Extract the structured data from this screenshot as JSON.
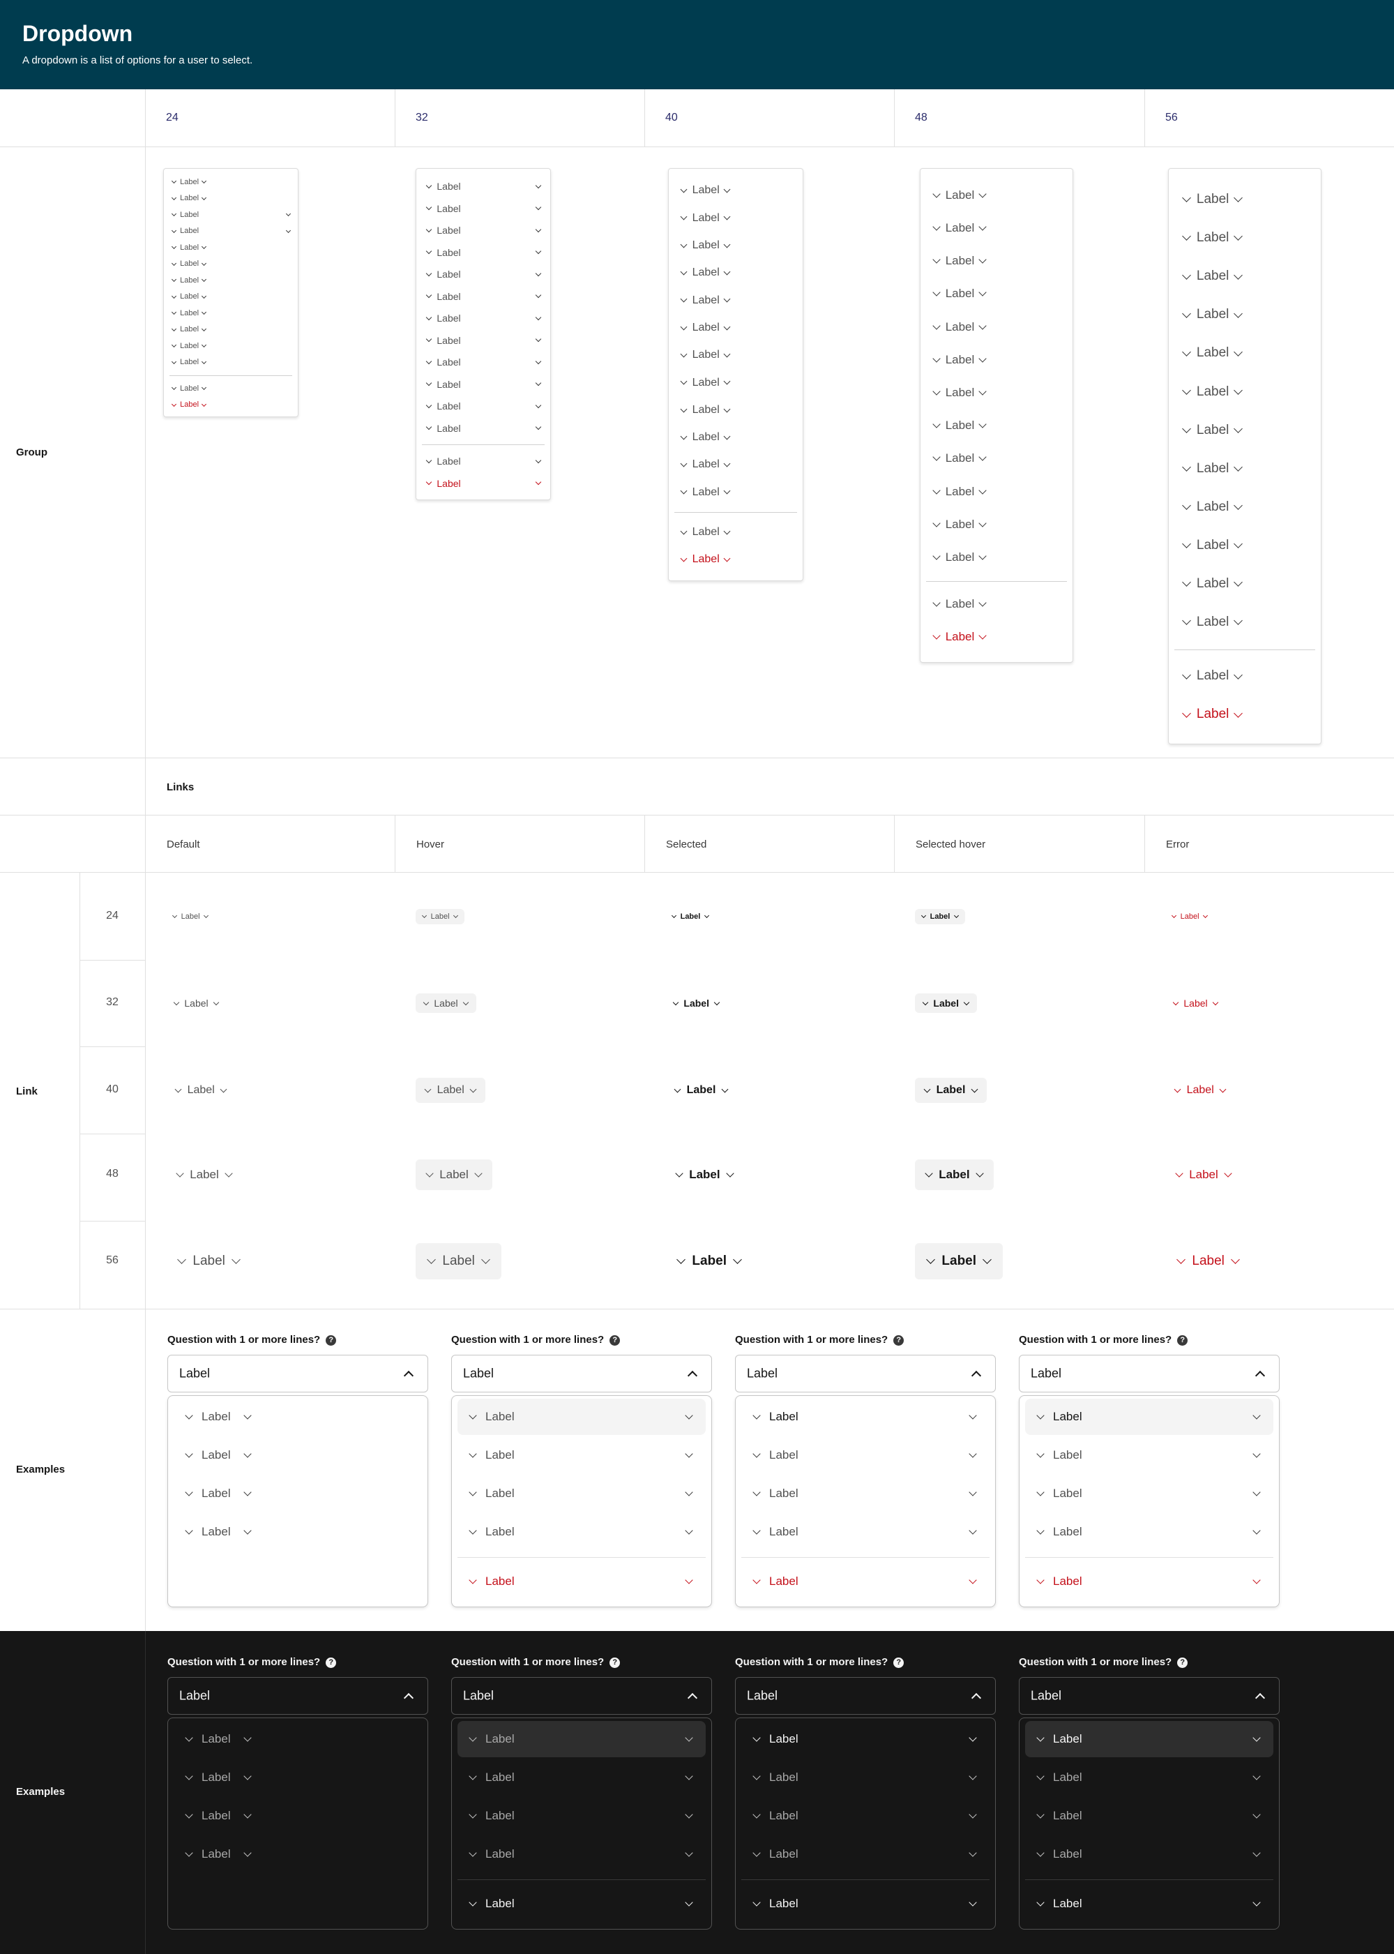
{
  "header": {
    "title": "Dropdown",
    "description": "A dropdown is a list of options for a user to select."
  },
  "sizes": [
    "24",
    "32",
    "40",
    "48",
    "56"
  ],
  "sections": {
    "group": "Group",
    "links": "Links",
    "link": "Link",
    "examples": "Examples"
  },
  "states": [
    "Default",
    "Hover",
    "Selected",
    "Selected hover",
    "Error"
  ],
  "item_label": "Label",
  "examples": {
    "question": "Question with 1 or more lines?",
    "help_icon": "?",
    "field_value": "Label"
  },
  "colors": {
    "header_bg": "#003c4f",
    "error": "#c4111b",
    "dark_bg": "#161616"
  }
}
